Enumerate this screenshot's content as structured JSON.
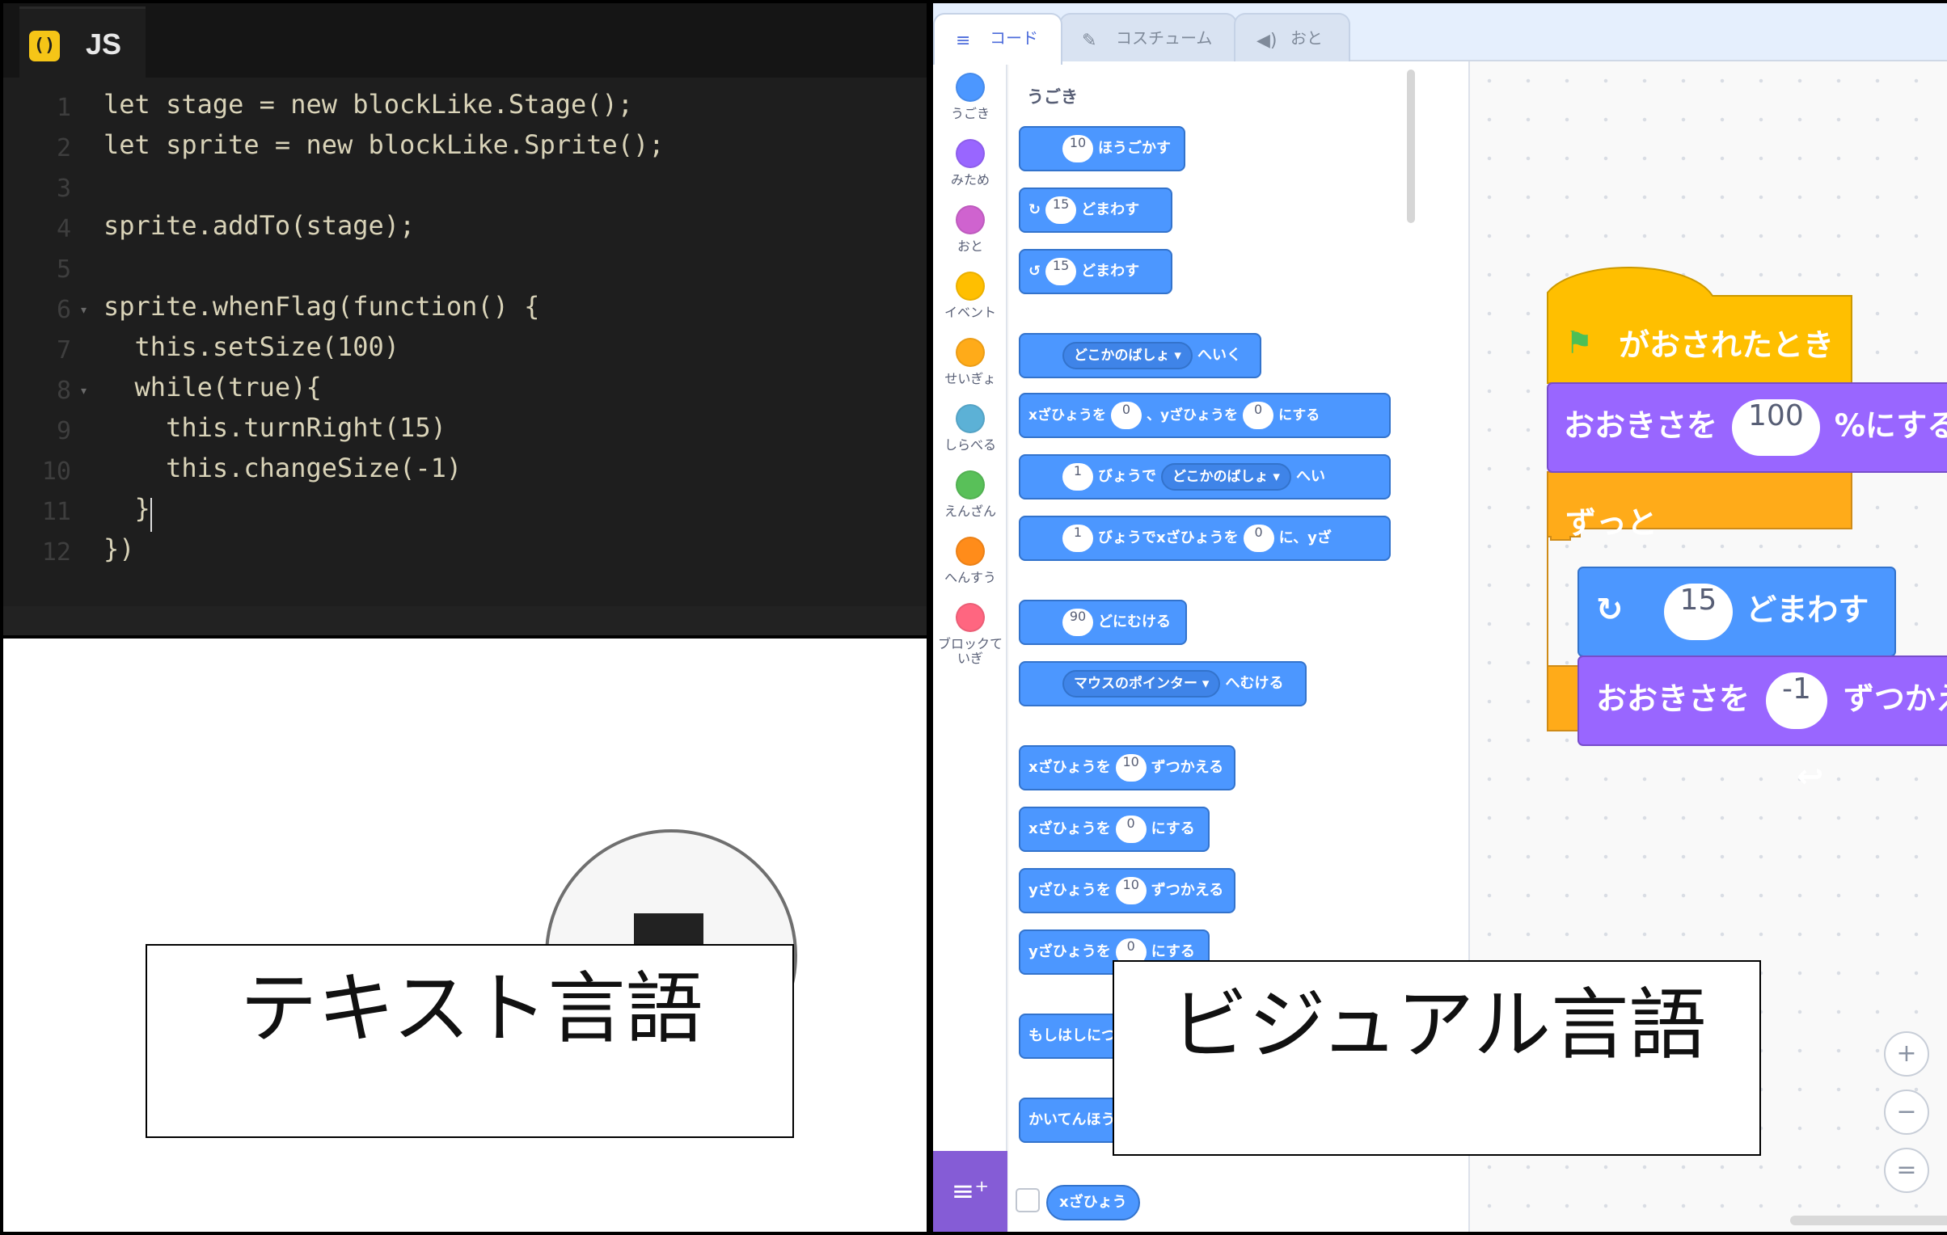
{
  "editor": {
    "tab_label": "JS",
    "icon_glyph": "()",
    "line_numbers": [
      "1",
      "2",
      "3",
      "4",
      "5",
      "6",
      "7",
      "8",
      "9",
      "10",
      "11",
      "12"
    ],
    "lines": [
      "let stage = new blockLike.Stage();",
      "let sprite = new blockLike.Sprite();",
      "",
      "sprite.addTo(stage);",
      "",
      "sprite.whenFlag(function() {",
      "  this.setSize(100)",
      "  while(true){",
      "    this.turnRight(15)",
      "    this.changeSize(-1)",
      "  }",
      "})"
    ]
  },
  "labels": {
    "text_language": "テキスト言語",
    "visual_language": "ビジュアル言語"
  },
  "scratch": {
    "tabs": [
      {
        "label": "コード",
        "icon": "code-icon"
      },
      {
        "label": "コスチューム",
        "icon": "brush-icon"
      },
      {
        "label": "おと",
        "icon": "speaker-icon"
      }
    ],
    "categories": [
      {
        "label": "うごき",
        "color": "#4c97ff"
      },
      {
        "label": "みため",
        "color": "#9966ff"
      },
      {
        "label": "おと",
        "color": "#cf63cf"
      },
      {
        "label": "イベント",
        "color": "#ffbf00"
      },
      {
        "label": "せいぎょ",
        "color": "#ffab19"
      },
      {
        "label": "しらべる",
        "color": "#5cb1d6"
      },
      {
        "label": "えんざん",
        "color": "#59c059"
      },
      {
        "label": "へんすう",
        "color": "#ff8c1a"
      },
      {
        "label": "ブロックて\nいぎ",
        "color": "#ff6680"
      }
    ],
    "palette_heading": "うごき",
    "palette": {
      "move": {
        "value": "10",
        "text": "ほうごかす"
      },
      "turn_right": {
        "value": "15",
        "text": "どまわす"
      },
      "turn_left": {
        "value": "15",
        "text": "どまわす"
      },
      "goto": {
        "dropdown": "どこかのばしょ ▾",
        "text": "へいく"
      },
      "goto_xy": {
        "t1": "xざひょうを",
        "v1": "0",
        "t2": "、yざひょうを",
        "v2": "0",
        "t3": "にする"
      },
      "glide": {
        "v1": "1",
        "t1": "びょうで",
        "dropdown": "どこかのばしょ ▾",
        "t2": "へい"
      },
      "glide_xy": {
        "v1": "1",
        "t1": "びょうでxざひょうを",
        "v2": "0",
        "t2": "に、yざ"
      },
      "point": {
        "value": "90",
        "text": "どにむける"
      },
      "point_towards": {
        "dropdown": "マウスのポインター ▾",
        "text": "へむける"
      },
      "change_x": {
        "t1": "xざひょうを",
        "value": "10",
        "t2": "ずつかえる"
      },
      "set_x": {
        "t1": "xざひょうを",
        "value": "0",
        "t2": "にする"
      },
      "change_y": {
        "t1": "yざひょうを",
        "value": "10",
        "t2": "ずつかえる"
      },
      "set_y": {
        "t1": "yざひょうを",
        "value": "0",
        "t2": "にする"
      },
      "if_edge": "もしはしにつ",
      "rotation": "かいてんほう",
      "xpos": "xざひょう"
    },
    "script": {
      "hat": "がおされたとき",
      "setsize": {
        "t1": "おおきさを",
        "value": "100",
        "t2": "%にする"
      },
      "forever": "ずっと",
      "turn": {
        "value": "15",
        "text": "どまわす"
      },
      "changesize": {
        "t1": "おおきさを",
        "value": "-1",
        "t2": "ずつかえる"
      }
    },
    "zoom": {
      "in": "+",
      "out": "−",
      "reset": "="
    },
    "colors": {
      "motion": "#4c97ff",
      "looks": "#9966ff",
      "events": "#ffbf00",
      "control": "#ffab19",
      "extension": "#855cd6"
    }
  }
}
